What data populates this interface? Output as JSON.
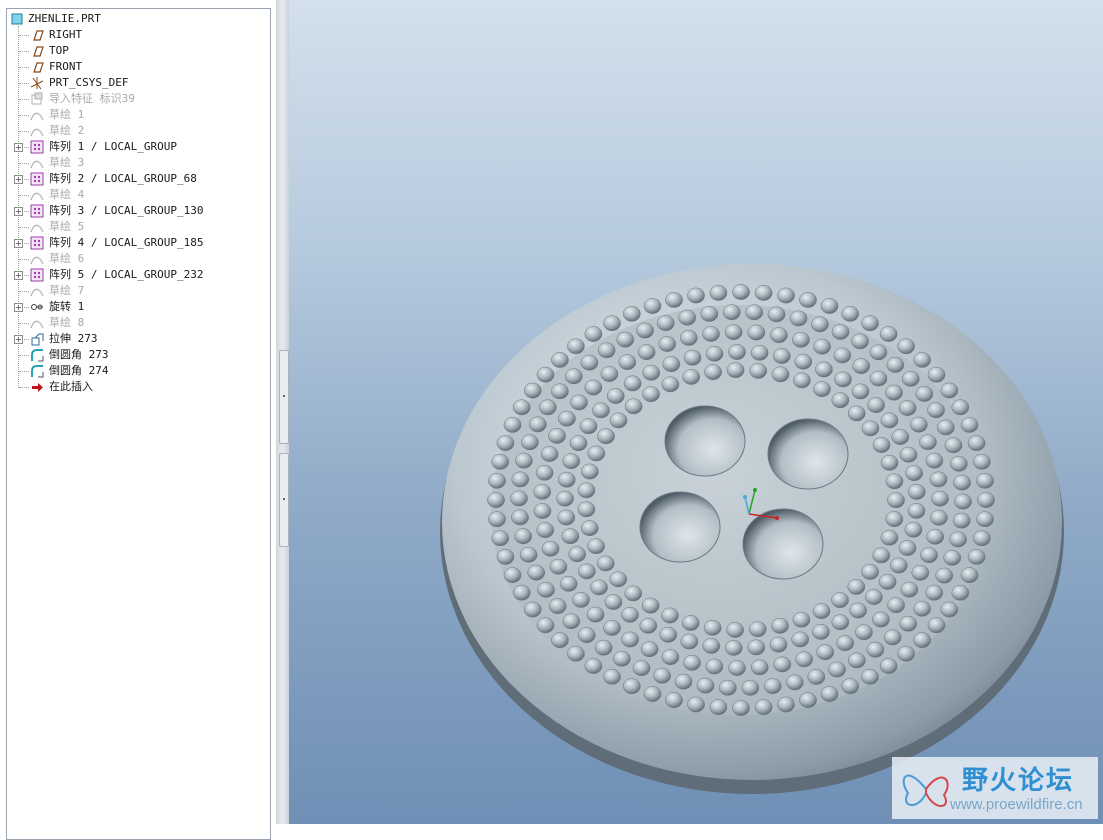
{
  "model_tree": {
    "root": {
      "label": "ZHENLIE.PRT",
      "icon": "part-icon"
    },
    "items": [
      {
        "label": "RIGHT",
        "icon": "datum-plane-icon",
        "dim": false,
        "expandable": false
      },
      {
        "label": "TOP",
        "icon": "datum-plane-icon",
        "dim": false,
        "expandable": false
      },
      {
        "label": "FRONT",
        "icon": "datum-plane-icon",
        "dim": false,
        "expandable": false
      },
      {
        "label": "PRT_CSYS_DEF",
        "icon": "coordinate-system-icon",
        "dim": false,
        "expandable": false
      },
      {
        "label": "导入特征 标识39",
        "icon": "import-feature-icon",
        "dim": true,
        "expandable": false
      },
      {
        "label": "草绘 1",
        "icon": "sketch-icon",
        "dim": true,
        "expandable": false
      },
      {
        "label": "草绘 2",
        "icon": "sketch-icon",
        "dim": true,
        "expandable": false
      },
      {
        "label": "阵列 1 / LOCAL_GROUP",
        "icon": "pattern-icon",
        "dim": false,
        "expandable": true
      },
      {
        "label": "草绘 3",
        "icon": "sketch-icon",
        "dim": true,
        "expandable": false
      },
      {
        "label": "阵列 2 / LOCAL_GROUP_68",
        "icon": "pattern-icon",
        "dim": false,
        "expandable": true
      },
      {
        "label": "草绘 4",
        "icon": "sketch-icon",
        "dim": true,
        "expandable": false
      },
      {
        "label": "阵列 3 / LOCAL_GROUP_130",
        "icon": "pattern-icon",
        "dim": false,
        "expandable": true
      },
      {
        "label": "草绘 5",
        "icon": "sketch-icon",
        "dim": true,
        "expandable": false
      },
      {
        "label": "阵列 4 / LOCAL_GROUP_185",
        "icon": "pattern-icon",
        "dim": false,
        "expandable": true
      },
      {
        "label": "草绘 6",
        "icon": "sketch-icon",
        "dim": true,
        "expandable": false
      },
      {
        "label": "阵列 5 / LOCAL_GROUP_232",
        "icon": "pattern-icon",
        "dim": false,
        "expandable": true
      },
      {
        "label": "草绘 7",
        "icon": "sketch-icon",
        "dim": true,
        "expandable": false
      },
      {
        "label": "旋转 1",
        "icon": "revolve-icon",
        "dim": false,
        "expandable": true
      },
      {
        "label": "草绘 8",
        "icon": "sketch-icon",
        "dim": true,
        "expandable": false
      },
      {
        "label": "拉伸 273",
        "icon": "extrude-icon",
        "dim": false,
        "expandable": true
      },
      {
        "label": "倒圆角 273",
        "icon": "round-icon",
        "dim": false,
        "expandable": false
      },
      {
        "label": "倒圆角 274",
        "icon": "round-icon",
        "dim": false,
        "expandable": false
      },
      {
        "label": "在此插入",
        "icon": "insert-here-arrow-icon",
        "dim": false,
        "expandable": false
      }
    ]
  },
  "watermark": {
    "title": "野火论坛",
    "url": "www.proewildfire.cn"
  },
  "colors": {
    "viewport_top": "#d3e0ec",
    "viewport_bottom": "#6f8fb6",
    "model_surface": "#b8c4cc",
    "datum_icon": "#8a4a1a",
    "pattern_icon": "#9a3fa6",
    "insert_arrow": "#c0141c",
    "watermark_text": "#2f8fd2"
  }
}
